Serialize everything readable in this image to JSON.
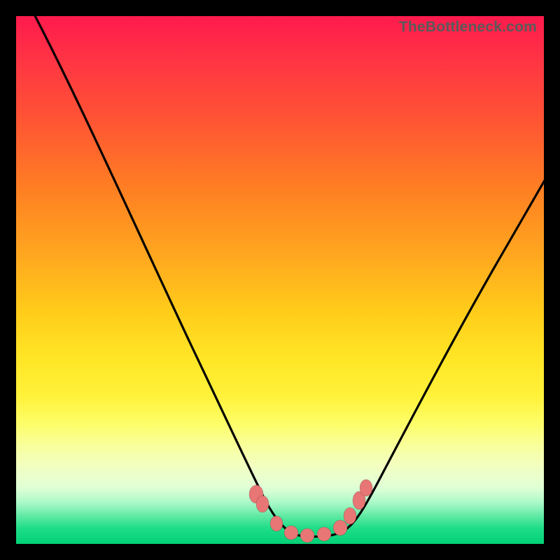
{
  "watermark": "TheBottleneck.com",
  "colors": {
    "frame": "#000000",
    "curve": "#000000",
    "marker": "#e77675",
    "gradient_top": "#ff1a4d",
    "gradient_bottom": "#00d177"
  },
  "chart_data": {
    "type": "line",
    "title": "",
    "xlabel": "",
    "ylabel": "",
    "xlim": [
      0,
      100
    ],
    "ylim": [
      0,
      100
    ],
    "note": "No axis ticks or numeric labels are visible; values below are pixel-fraction estimates (0–100 of plot width/height, y=0 at bottom).",
    "series": [
      {
        "name": "left-arm",
        "x": [
          3,
          8,
          14,
          20,
          26,
          32,
          37,
          41,
          44,
          47,
          49.5,
          51.5,
          53
        ],
        "y": [
          100,
          88,
          75,
          62,
          50,
          38,
          28,
          19,
          12,
          7,
          4,
          2.2,
          1.5
        ]
      },
      {
        "name": "floor",
        "x": [
          53,
          55,
          57,
          59,
          61
        ],
        "y": [
          1.5,
          1.3,
          1.3,
          1.5,
          2
        ]
      },
      {
        "name": "right-arm",
        "x": [
          61,
          64,
          68,
          73,
          79,
          86,
          93,
          100
        ],
        "y": [
          2,
          5,
          11,
          20,
          31,
          44,
          57,
          69
        ]
      }
    ],
    "markers": {
      "name": "highlight-dots",
      "x": [
        45.5,
        46.5,
        49,
        52,
        55,
        58,
        61.5,
        63,
        64.8,
        66
      ],
      "y": [
        9.5,
        7.5,
        3.8,
        2.2,
        1.8,
        2.2,
        3.2,
        5.5,
        8.5,
        11
      ]
    }
  }
}
